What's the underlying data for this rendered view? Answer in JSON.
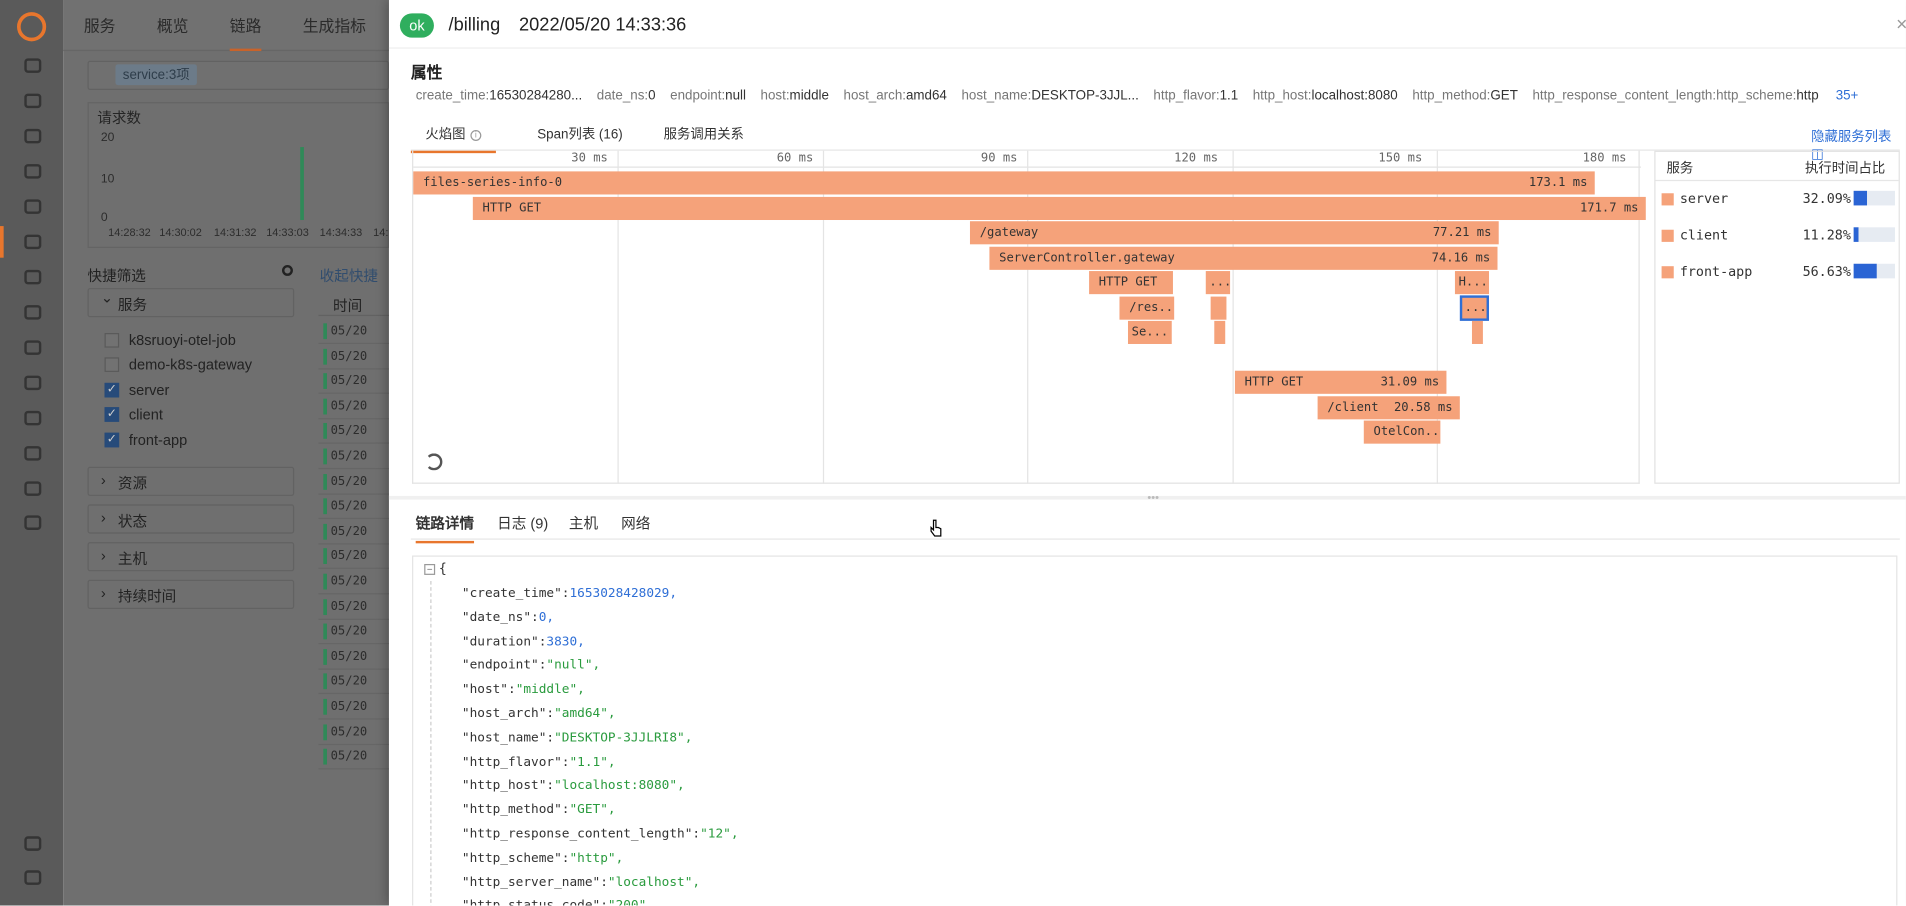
{
  "background": {
    "nav": [
      "服务",
      "概览",
      "链路",
      "生成指标"
    ],
    "search_tag": "service:3项",
    "chart_title": "请求数",
    "y_ticks": [
      "20",
      "10",
      "0"
    ],
    "x_ticks": [
      "14:28:32",
      "14:30:02",
      "14:31:32",
      "14:33:03",
      "14:34:33",
      "14:"
    ],
    "quick_filter": "快捷筛选",
    "collapse_label": "收起快捷",
    "groups": [
      "服务",
      "资源",
      "状态",
      "主机",
      "持续时间"
    ],
    "services": [
      {
        "label": "k8sruoyi-otel-job",
        "checked": false
      },
      {
        "label": "demo-k8s-gateway",
        "checked": false
      },
      {
        "label": "server",
        "checked": true
      },
      {
        "label": "client",
        "checked": true
      },
      {
        "label": "front-app",
        "checked": true
      }
    ],
    "table_header": "时间",
    "row_date": "05/20"
  },
  "header": {
    "status": "ok",
    "route": "/billing",
    "timestamp": "2022/05/20 14:33:36",
    "close": "×"
  },
  "attributes": {
    "title": "属性",
    "items": [
      {
        "k": "create_time:",
        "v": "16530284280..."
      },
      {
        "k": "date_ns:",
        "v": "0"
      },
      {
        "k": "endpoint:",
        "v": "null"
      },
      {
        "k": "host:",
        "v": "middle"
      },
      {
        "k": "host_arch:",
        "v": "amd64"
      },
      {
        "k": "host_name:",
        "v": "DESKTOP-3JJL..."
      },
      {
        "k": "http_flavor:",
        "v": "1.1"
      },
      {
        "k": "http_host:",
        "v": "localhost:8080"
      },
      {
        "k": "http_method:",
        "v": "GET"
      },
      {
        "k": "http_response_content_length:",
        "v": ""
      },
      {
        "k": "http_scheme:",
        "v": "http"
      }
    ],
    "more": "35+"
  },
  "view_tabs": {
    "flame": "火焰图",
    "span_list": "Span列表 (16)",
    "service_map": "服务调用关系",
    "hide_services": "隐藏服务列表"
  },
  "flame": {
    "ticks": [
      "30 ms",
      "60 ms",
      "90 ms",
      "120 ms",
      "150 ms",
      "180 ms"
    ],
    "spans": [
      {
        "name": "files-series-info-0",
        "duration": "173.1 ms"
      },
      {
        "name": "HTTP GET",
        "duration": "171.7 ms"
      },
      {
        "name": "/gateway",
        "duration": "77.21 ms"
      },
      {
        "name": "ServerController.gateway",
        "duration": "74.16 ms"
      },
      {
        "name": "HTTP GET",
        "duration": ""
      },
      {
        "name": "...",
        "duration": ""
      },
      {
        "name": "H...",
        "duration": ""
      },
      {
        "name": "/res...",
        "duration": ""
      },
      {
        "name": "",
        "duration": ""
      },
      {
        "name": "...",
        "duration": ""
      },
      {
        "name": "Se...",
        "duration": ""
      },
      {
        "name": "",
        "duration": ""
      },
      {
        "name": "",
        "duration": ""
      },
      {
        "name": "HTTP GET",
        "duration": "31.09 ms"
      },
      {
        "name": "/client",
        "duration": "20.58 ms"
      },
      {
        "name": "OtelCon...",
        "duration": ""
      }
    ]
  },
  "services_panel": {
    "col_service": "服务",
    "col_ratio": "执行时间占比",
    "rows": [
      {
        "name": "server",
        "pct": "32.09%",
        "ratio": 0.3209
      },
      {
        "name": "client",
        "pct": "11.28%",
        "ratio": 0.1128
      },
      {
        "name": "front-app",
        "pct": "56.63%",
        "ratio": 0.5663
      }
    ],
    "accent": "#2a64d4"
  },
  "detail_tabs": [
    "链路详情",
    "日志 (9)",
    "主机",
    "网络"
  ],
  "json": {
    "open": "{",
    "lines": [
      {
        "k": "\"create_time\":",
        "v": "1653028428029,",
        "t": "n"
      },
      {
        "k": "\"date_ns\":",
        "v": "0,",
        "t": "n"
      },
      {
        "k": "\"duration\":",
        "v": "3830,",
        "t": "n"
      },
      {
        "k": "\"endpoint\":",
        "v": "\"null\",",
        "t": "s"
      },
      {
        "k": "\"host\":",
        "v": "\"middle\",",
        "t": "s"
      },
      {
        "k": "\"host_arch\":",
        "v": "\"amd64\",",
        "t": "s"
      },
      {
        "k": "\"host_name\":",
        "v": "\"DESKTOP-3JJLRI8\",",
        "t": "s"
      },
      {
        "k": "\"http_flavor\":",
        "v": "\"1.1\",",
        "t": "s"
      },
      {
        "k": "\"http_host\":",
        "v": "\"localhost:8080\",",
        "t": "s"
      },
      {
        "k": "\"http_method\":",
        "v": "\"GET\",",
        "t": "s"
      },
      {
        "k": "\"http_response_content_length\":",
        "v": "\"12\",",
        "t": "s"
      },
      {
        "k": "\"http_scheme\":",
        "v": "\"http\",",
        "t": "s"
      },
      {
        "k": "\"http_server_name\":",
        "v": "\"localhost\",",
        "t": "s"
      },
      {
        "k": "\"http_status_code\":",
        "v": "\"200\",",
        "t": "s"
      }
    ]
  },
  "colors": {
    "span": "#f5a27a",
    "ok": "#2fae5e",
    "accent": "#e8762d",
    "link": "#2f6fd6"
  }
}
